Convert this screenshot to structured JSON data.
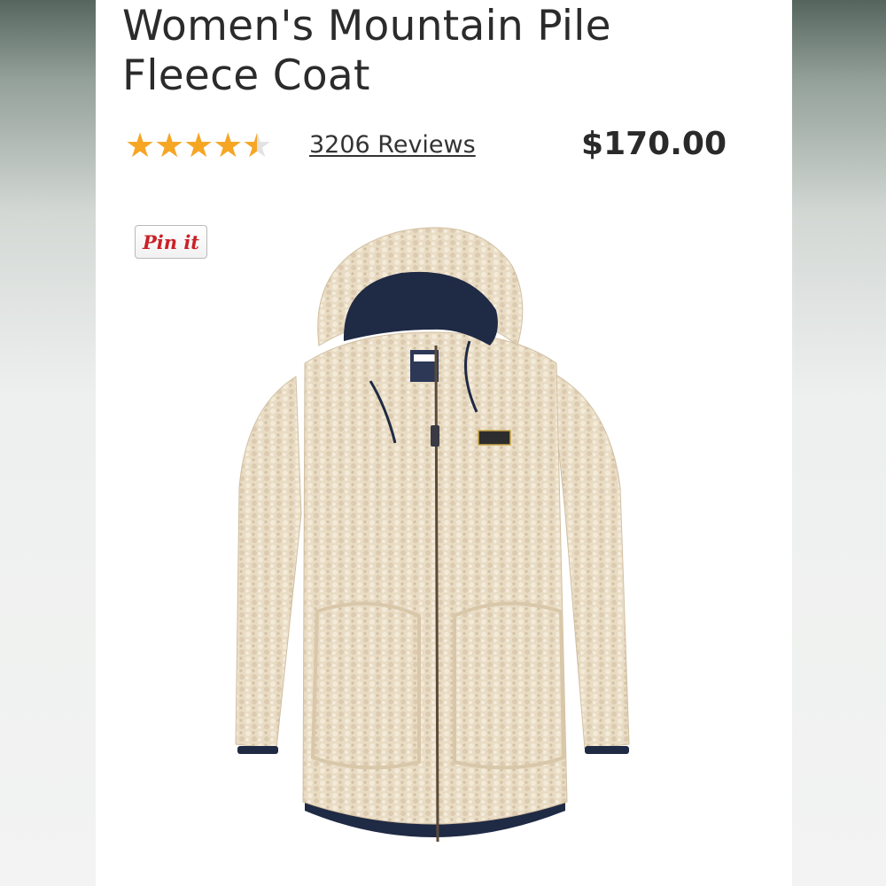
{
  "product": {
    "title": "Women's Mountain Pile Fleece Coat",
    "rating": 4.5,
    "rating_max": 5,
    "reviews_text": "3206 Reviews",
    "price": "$170.00",
    "pin_button_label": "Pin it",
    "star_color": "#f6a623",
    "coat_color": "#e9dcc4",
    "lining_color": "#1f2a44"
  }
}
